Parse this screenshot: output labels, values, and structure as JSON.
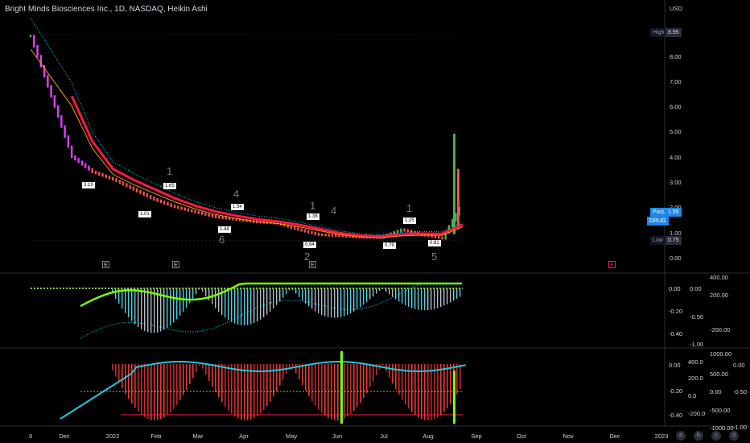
{
  "header": {
    "title": "Bright Minds Biosciences Inc., 1D, NASDAQ, Heikin Ashi"
  },
  "price_axis": {
    "currency": "USD",
    "ticks": [
      "8.00",
      "7.00",
      "6.00",
      "5.00",
      "4.00",
      "3.00",
      "2.00",
      "1.00",
      "0.00"
    ],
    "high_key": "High",
    "high_val": "8.95",
    "pocl_key": "PocL",
    "pocl_val": "1.55",
    "symbol_tag": "DRUG",
    "low_key": "Low",
    "low_val": "0.75"
  },
  "pane2_axis": {
    "left_ticks": [
      "0.00",
      "-0.20",
      "-0.40"
    ],
    "mid_ticks": [
      "0.00",
      "-0.50",
      "-1.00"
    ],
    "right_ticks": [
      "400.00",
      "200.00",
      "-200.00"
    ]
  },
  "pane3_axis": {
    "left_ticks": [
      "0.00",
      "-0.20",
      "-0.40"
    ],
    "mid_ticks": [
      "400.0",
      "200.0",
      "0.0",
      "-200.0"
    ],
    "right_ticks": [
      "1000.00",
      "500.00",
      "0.00",
      "-500.00",
      "-1000.00"
    ],
    "far_ticks": [
      "0.00",
      "-0.50",
      "-1.00"
    ]
  },
  "time_axis": [
    "9",
    "Dec",
    "2022",
    "Feb",
    "Mar",
    "Apr",
    "May",
    "Jun",
    "Jul",
    "Aug",
    "Sep",
    "Oct",
    "Nov",
    "Dec",
    "2023"
  ],
  "earnings_marker": "E",
  "wave_counts": [
    "1",
    "4",
    "6",
    "1",
    "4",
    "2",
    "1",
    "5"
  ],
  "price_tags": [
    "3.19",
    "1.65",
    "1.01",
    "1.54",
    "1.44",
    "1.38",
    "0.94",
    "1.25",
    "0.79",
    "0.81"
  ],
  "bottom_icons": [
    "a",
    "b",
    "c",
    "d"
  ],
  "colors": {
    "bg": "#000000",
    "up": "#26a69a",
    "down": "#ef5350",
    "green": "#4caf50",
    "lime": "#76ff03",
    "cyan": "#00e5ff",
    "red": "#ff1744",
    "accent": "#1e88e5"
  },
  "chart_data": {
    "type": "candlestick",
    "x": [
      "Nov 9",
      "Nov 23",
      "Dec 7",
      "Dec 21",
      "Jan 4",
      "Jan 18",
      "Feb 1",
      "Feb 15",
      "Mar 1",
      "Mar 15",
      "Mar 29",
      "Apr 12",
      "Apr 26",
      "May 10",
      "May 24",
      "Jun 7",
      "Jun 21",
      "Jul 5",
      "Jul 19",
      "Aug 2",
      "Aug 16",
      "Aug 23"
    ],
    "close": [
      8.9,
      6.5,
      4.1,
      3.5,
      3.2,
      2.8,
      2.4,
      2.1,
      1.9,
      1.7,
      1.6,
      1.5,
      1.45,
      1.2,
      1.0,
      0.95,
      0.9,
      0.88,
      1.2,
      1.0,
      0.85,
      2.3
    ],
    "high_mark": 8.95,
    "low_mark": 0.75,
    "ylim": [
      0,
      9.5
    ]
  }
}
